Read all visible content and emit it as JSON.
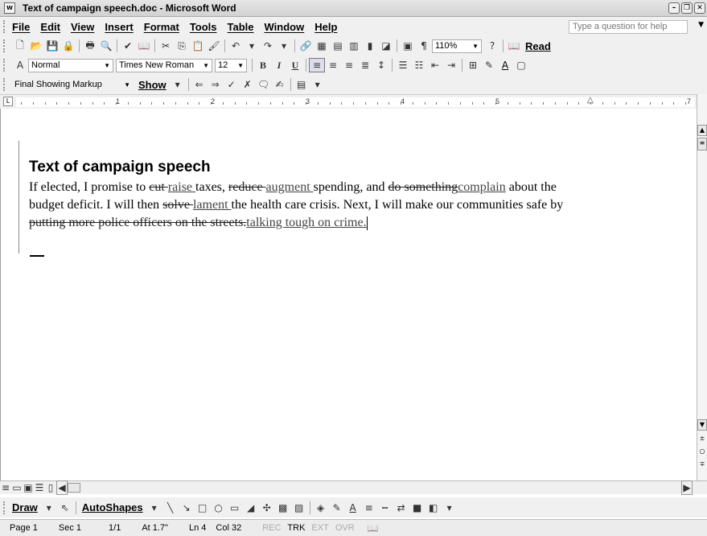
{
  "window": {
    "title": "Text of campaign speech.doc - Microsoft Word",
    "app_icon": "W"
  },
  "menu": [
    "File",
    "Edit",
    "View",
    "Insert",
    "Format",
    "Tools",
    "Table",
    "Window",
    "Help"
  ],
  "help": {
    "placeholder": "Type a question for help"
  },
  "standard_toolbar": {
    "zoom": "110%",
    "read_label": "Read"
  },
  "formatting_toolbar": {
    "style": "Normal",
    "font": "Times New Roman",
    "size": "12",
    "bold": "B",
    "italic": "I",
    "underline": "U"
  },
  "reviewing_toolbar": {
    "display": "Final Showing Markup",
    "show_label": "Show"
  },
  "ruler": {
    "numbers": [
      "1",
      "2",
      "3",
      "4",
      "5",
      "7"
    ]
  },
  "document": {
    "heading": "Text of campaign speech",
    "segments": [
      {
        "t": "If elected, I promise to ",
        "k": "n"
      },
      {
        "t": "cut ",
        "k": "d"
      },
      {
        "t": "raise ",
        "k": "i"
      },
      {
        "t": "taxes, ",
        "k": "n"
      },
      {
        "t": "reduce ",
        "k": "d"
      },
      {
        "t": "augment ",
        "k": "i"
      },
      {
        "t": "spending, and ",
        "k": "n"
      },
      {
        "t": "do something",
        "k": "d"
      },
      {
        "t": "complain",
        "k": "i"
      },
      {
        "t": " about the budget deficit. I will then ",
        "k": "n"
      },
      {
        "t": "solve ",
        "k": "d"
      },
      {
        "t": "lament ",
        "k": "i"
      },
      {
        "t": "the health care crisis. Next, I will make our communities safe by ",
        "k": "n"
      },
      {
        "t": "putting more police officers on the streets.",
        "k": "d"
      },
      {
        "t": "talking tough on crime.",
        "k": "i"
      }
    ]
  },
  "drawing_toolbar": {
    "draw_label": "Draw",
    "autoshapes_label": "AutoShapes"
  },
  "status": {
    "page": "Page 1",
    "sec": "Sec 1",
    "pages": "1/1",
    "at": "At 1.7\"",
    "ln": "Ln 4",
    "col": "Col 32",
    "rec": "REC",
    "trk": "TRK",
    "ext": "EXT",
    "ovr": "OVR"
  }
}
